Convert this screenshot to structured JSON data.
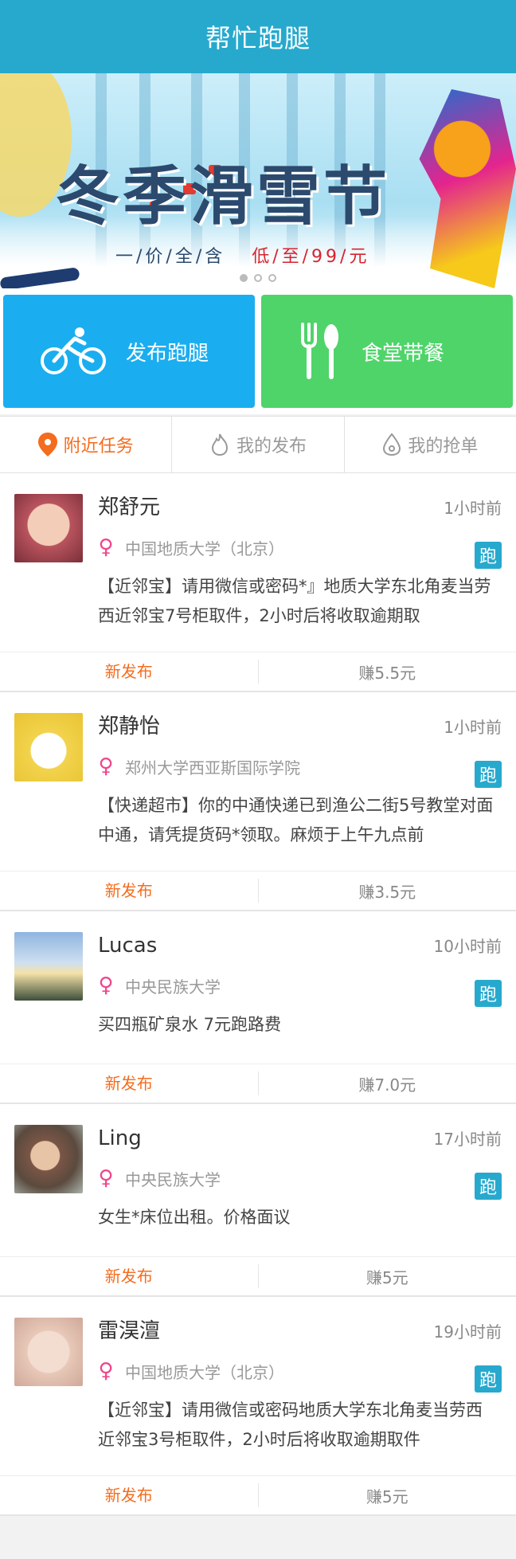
{
  "header": {
    "title": "帮忙跑腿"
  },
  "banner": {
    "title": "冬季滑雪节",
    "subtitle_left": "一/价/全/含",
    "subtitle_right": "低/至/99/元",
    "slide_count": 3,
    "active_slide": 0
  },
  "actions": [
    {
      "label": "发布跑腿",
      "icon": "bicycle-icon",
      "color": "#1aaef0"
    },
    {
      "label": "食堂带餐",
      "icon": "fork-knife-icon",
      "color": "#4fd46a"
    }
  ],
  "tabs": [
    {
      "label": "附近任务",
      "icon": "location-pin-icon",
      "active": true
    },
    {
      "label": "我的发布",
      "icon": "flame-icon",
      "active": false
    },
    {
      "label": "我的抢单",
      "icon": "drop-icon",
      "active": false
    }
  ],
  "tasks": [
    {
      "name": "郑舒元",
      "time": "1小时前",
      "gender": "♀",
      "school": "中国地质大学（北京）",
      "badge": "跑",
      "desc": "【近邻宝】请用微信或密码*』地质大学东北角麦当劳西近邻宝7号柜取件，2小时后将收取逾期取",
      "status": "新发布",
      "reward": "赚5.5元",
      "avatar_color": "#b9545e"
    },
    {
      "name": "郑静怡",
      "time": "1小时前",
      "gender": "♀",
      "school": "郑州大学西亚斯国际学院",
      "badge": "跑",
      "desc": "【快递超市】你的中通快递已到渔公二街5号教堂对面中通，请凭提货码*领取。麻烦于上午九点前",
      "status": "新发布",
      "reward": "赚3.5元",
      "avatar_color": "#f2d34c"
    },
    {
      "name": "Lucas",
      "time": "10小时前",
      "gender": "♀",
      "school": "中央民族大学",
      "badge": "跑",
      "desc": "买四瓶矿泉水 7元跑路费",
      "status": "新发布",
      "reward": "赚7.0元",
      "avatar_color": "#7fa6d6"
    },
    {
      "name": "Ling",
      "time": "17小时前",
      "gender": "♀",
      "school": "中央民族大学",
      "badge": "跑",
      "desc": "女生*床位出租。价格面议",
      "status": "新发布",
      "reward": "赚5元",
      "avatar_color": "#8a6552"
    },
    {
      "name": "雷淏澶",
      "time": "19小时前",
      "gender": "♀",
      "school": "中国地质大学（北京）",
      "badge": "跑",
      "desc": "【近邻宝】请用微信或密码地质大学东北角麦当劳西近邻宝3号柜取件，2小时后将收取逾期取件",
      "status": "新发布",
      "reward": "赚5元",
      "avatar_color": "#e8c8b8"
    }
  ]
}
